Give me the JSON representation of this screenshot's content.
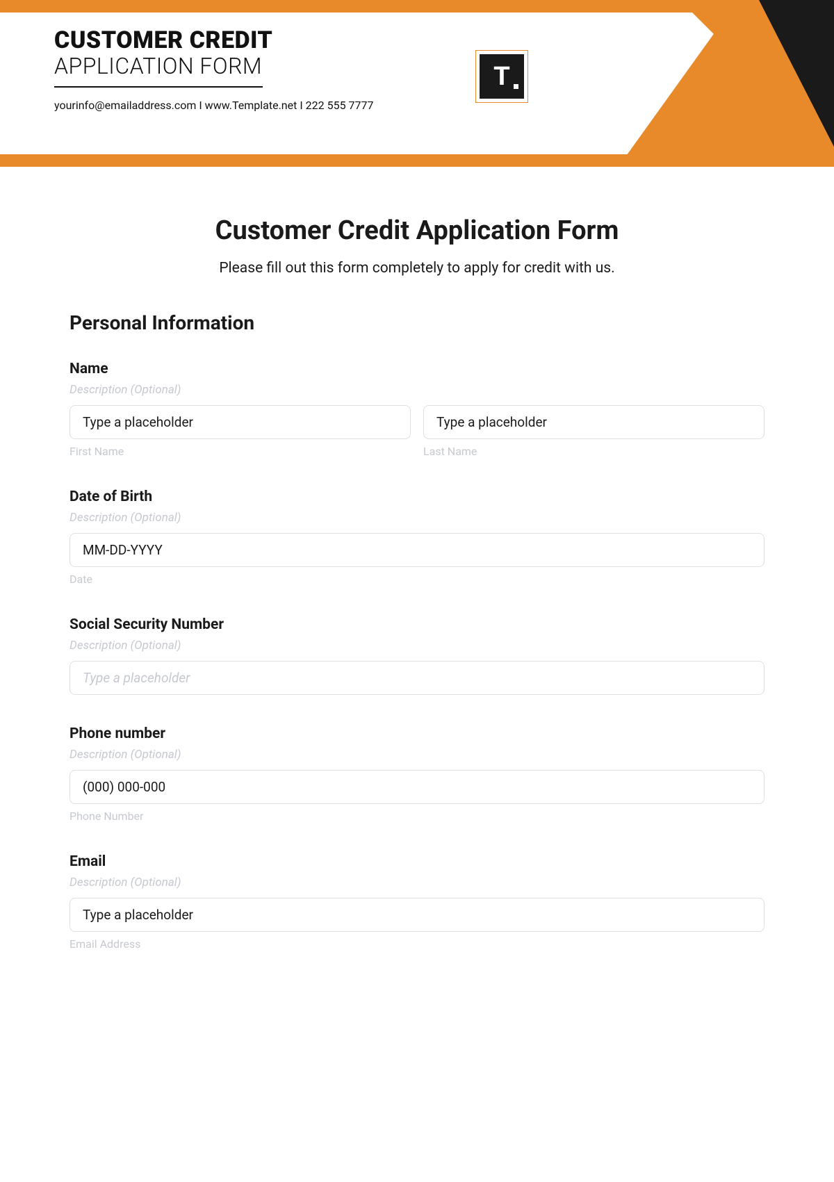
{
  "banner": {
    "title_bold": "CUSTOMER CREDIT",
    "title_light": "APPLICATION FORM",
    "contact": "yourinfo@emailaddress.com  I  www.Template.net  I  222 555 7777",
    "logo_letter": "T"
  },
  "form": {
    "title": "Customer Credit Application Form",
    "subtitle": "Please fill out this form completely to apply for credit with us.",
    "section_heading": "Personal Information",
    "desc_optional": "Description (Optional)",
    "name": {
      "label": "Name",
      "first_placeholder": "Type a placeholder",
      "first_sub": "First Name",
      "last_placeholder": "Type a placeholder",
      "last_sub": "Last Name"
    },
    "dob": {
      "label": "Date of Birth",
      "placeholder": "MM-DD-YYYY",
      "sub": "Date"
    },
    "ssn": {
      "label": "Social Security Number",
      "placeholder": "Type a placeholder"
    },
    "phone": {
      "label": "Phone number",
      "placeholder": "(000) 000-000",
      "sub": "Phone Number"
    },
    "email": {
      "label": "Email",
      "placeholder": "Type a placeholder",
      "sub": "Email Address"
    }
  }
}
